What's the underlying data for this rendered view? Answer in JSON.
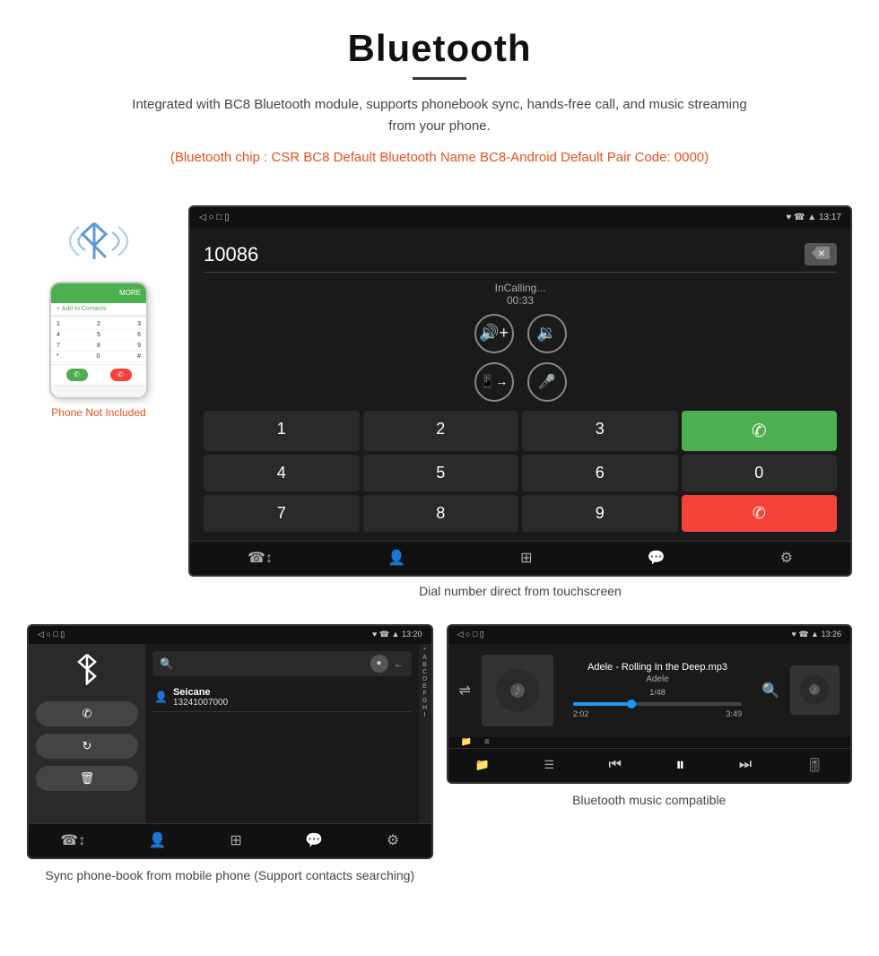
{
  "header": {
    "title": "Bluetooth",
    "description": "Integrated with BC8 Bluetooth module, supports phonebook sync, hands-free call, and music streaming from your phone.",
    "specs": "(Bluetooth chip : CSR BC8    Default Bluetooth Name BC8-Android    Default Pair Code: 0000)"
  },
  "phone_illustration": {
    "not_included_label": "Phone Not Included"
  },
  "dialer_screen": {
    "status_bar": {
      "left_icons": "◁  ○  □  ▯",
      "right_icons": "♥ ☎ ▲ 13:17"
    },
    "number": "10086",
    "calling_status": "InCalling...",
    "timer": "00:33",
    "keys": [
      "1",
      "2",
      "3",
      "*",
      "4",
      "5",
      "6",
      "0",
      "7",
      "8",
      "9",
      "#"
    ],
    "caption": "Dial number direct from touchscreen"
  },
  "phonebook_screen": {
    "status_bar": {
      "left_icons": "◁  ○  □  ▯",
      "right_icons": "♥ ☎ ▲ 13:20"
    },
    "contact": {
      "name": "Seicane",
      "number": "13241007000"
    },
    "alpha_letters": [
      "*",
      "A",
      "B",
      "C",
      "D",
      "E",
      "F",
      "G",
      "H",
      "I"
    ],
    "caption": "Sync phone-book from mobile phone\n(Support contacts searching)"
  },
  "music_screen": {
    "status_bar": {
      "left_icons": "◁  ○  □  ▯",
      "right_icons": "♥ ☎ ▲ 13:26"
    },
    "song_title": "Adele - Rolling In the Deep.mp3",
    "artist": "Adele",
    "track_info": "1/48",
    "time_current": "2:02",
    "time_total": "3:49",
    "caption": "Bluetooth music compatible"
  },
  "nav_icons": {
    "calls": "☎",
    "contacts": "👤",
    "dialpad": "⊞",
    "messages": "💬",
    "settings": "⚙"
  }
}
